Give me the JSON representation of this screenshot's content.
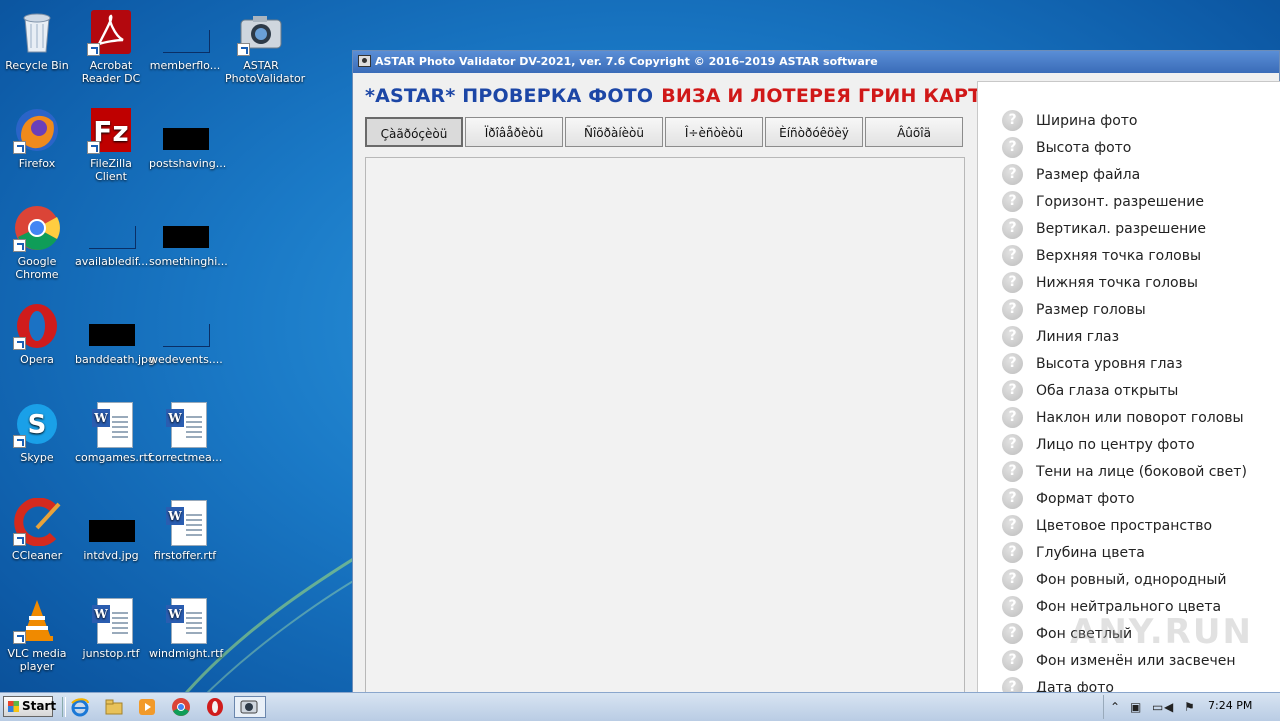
{
  "desktop": {
    "icons": [
      {
        "label": "Recycle Bin"
      },
      {
        "label": "Acrobat Reader DC"
      },
      {
        "label": "memberflo..."
      },
      {
        "label": "ASTAR PhotoValidator"
      },
      {
        "label": "Firefox"
      },
      {
        "label": "FileZilla Client"
      },
      {
        "label": "postshaving..."
      },
      {
        "label": "Google Chrome"
      },
      {
        "label": "availabledif..."
      },
      {
        "label": "somethinghi..."
      },
      {
        "label": "Opera"
      },
      {
        "label": "banddeath.jpg"
      },
      {
        "label": "wedevents...."
      },
      {
        "label": "Skype"
      },
      {
        "label": "comgames.rtf"
      },
      {
        "label": "correctmea..."
      },
      {
        "label": "CCleaner"
      },
      {
        "label": "intdvd.jpg"
      },
      {
        "label": "firstoffer.rtf"
      },
      {
        "label": "VLC media player"
      },
      {
        "label": "junstop.rtf"
      },
      {
        "label": "windmight.rtf"
      }
    ]
  },
  "window": {
    "title": "ASTAR Photo Validator DV-2021, ver. 7.6  Copyright © 2016–2019 ASTAR software",
    "header_blue": "*ASTAR* ПРОВЕРКА ФОТО",
    "header_red": "ВИЗА И ЛОТЕРЕЯ ГРИН КАРТА",
    "tabs": [
      "Çàãðóçèòü",
      "Ïðîâåðèòü",
      "Ñîõðàíèòü",
      "Î÷èñòèòü",
      "Èíñòðóêöèÿ",
      "Âûõîä"
    ],
    "checks": [
      "Ширина фото",
      "Высота фото",
      "Размер файла",
      "Горизонт. разрешение",
      "Вертикал. разрешение",
      "Верхняя точка головы",
      "Нижняя точка головы",
      "Размер головы",
      "Линия глаз",
      "Высота уровня глаз",
      "Оба глаза открыты",
      "Наклон или поворот головы",
      "Лицо по центру фото",
      "Тени на лице (боковой свет)",
      "Формат фото",
      "Цветовое пространство",
      "Глубина цвета",
      "Фон ровный, однородный",
      "Фон нейтрального цвета",
      "Фон светлый",
      "Фон изменён или засвечен",
      "Дата фото"
    ],
    "status_glyph": "?"
  },
  "taskbar": {
    "start_label": "Start",
    "clock": "7:24 PM"
  },
  "watermark": "ANY.RUN"
}
